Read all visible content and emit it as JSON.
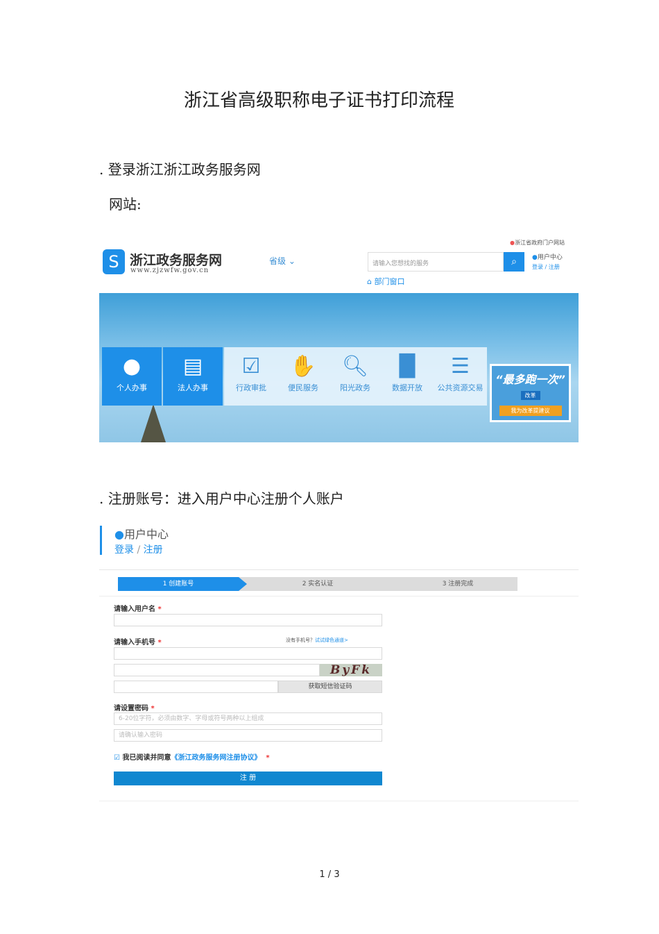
{
  "title": "浙江省高级职称电子证书打印流程",
  "step1": ". 登录浙江浙江政务服务网",
  "site_label": "网站:",
  "step2": ". 注册账号：进入用户中心注册个人账户",
  "portal": {
    "logo_name": "浙江政务服务网",
    "logo_url": "www.zjzwfw.gov.cn",
    "level": "省级",
    "gov_link": "浙江省政府门户网站",
    "search_placeholder": "请输入您想找的服务",
    "dept": "部门窗口",
    "user_center": "用户中心",
    "login": "登录",
    "sep": " / ",
    "register": "注册",
    "tiles": [
      "个人办事",
      "法人办事",
      "行政审批",
      "便民服务",
      "阳光政务",
      "数据开放",
      "公共资源交易"
    ],
    "promo_title": "“最多跑一次”",
    "promo_sub": "改革",
    "promo_btn": "我为改革提建议"
  },
  "usercenter": {
    "title": "用户中心",
    "login": "登录",
    "sep": " / ",
    "register": "注册"
  },
  "reg": {
    "steps": [
      "1 创建账号",
      "2 实名认证",
      "3 注册完成"
    ],
    "username_label": "请输入用户名",
    "phone_label": "请输入手机号",
    "no_phone": "没有手机号？",
    "green_channel": "试试绿色通道>",
    "captcha": "ByFk",
    "sms_btn": "获取短信验证码",
    "pwd_label": "请设置密码",
    "pwd_placeholder": "6-20位字符，必须由数字、字母或符号两种以上组成",
    "confirm_placeholder": "请确认输入密码",
    "agree": "我已阅读并同意",
    "agreement": "《浙江政务服务网注册协议》",
    "submit": "注 册",
    "req": "*"
  },
  "page": "1 / 3"
}
